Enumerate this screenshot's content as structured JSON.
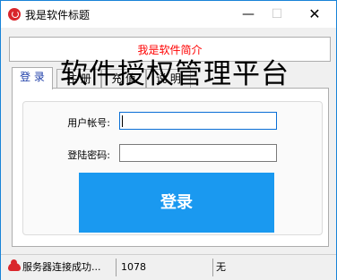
{
  "window": {
    "title": "我是软件标题",
    "minimize_glyph": "—",
    "maximize_glyph": "☐",
    "close_glyph": "✕"
  },
  "intro": {
    "text": "我是软件简介"
  },
  "tabs": [
    {
      "label": "登 录",
      "active": true
    },
    {
      "label": "注 册",
      "active": false
    },
    {
      "label": "充 值",
      "active": false
    },
    {
      "label": "说 明",
      "active": false
    }
  ],
  "big_title": "软件授权管理平台",
  "login": {
    "user_label": "用户帐号:",
    "pass_label": "登陆密码:",
    "user_value": "",
    "pass_value": "",
    "submit_label": "登录"
  },
  "status": {
    "icon": "cloud-icon",
    "message": "服务器连接成功...",
    "count": "1078",
    "extra": "无"
  },
  "colors": {
    "accent": "#1a99f0",
    "window_border": "#1883d7",
    "intro_text": "#ff0000",
    "icon_red": "#d9262c"
  }
}
